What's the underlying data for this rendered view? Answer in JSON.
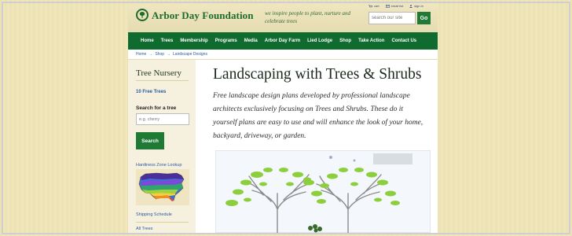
{
  "header": {
    "logo_text": "Arbor Day Foundation",
    "tagline": "we inspire people to plant, nurture and celebrate trees",
    "util_links": [
      "cart",
      "email list",
      "sign in"
    ],
    "search_placeholder": "search our site",
    "go_label": "Go"
  },
  "nav": {
    "items": [
      "Home",
      "Trees",
      "Membership",
      "Programs",
      "Media",
      "Arbor Day Farm",
      "Lied Lodge",
      "Shop",
      "Take Action",
      "Contact Us"
    ]
  },
  "breadcrumb": {
    "items": [
      "Home",
      "Shop",
      "Landscape Designs"
    ],
    "separator": "→"
  },
  "sidebar": {
    "title": "Tree Nursery",
    "free_trees_link": "10 Free Trees",
    "search_label": "Search for a tree",
    "search_placeholder": "e.g. cherry",
    "search_button": "Search",
    "hardiness_link": "Hardiness Zone Lookup",
    "shipping_link": "Shipping Schedule",
    "all_trees_link": "All Trees"
  },
  "main": {
    "title": "Landscaping with Trees & Shrubs",
    "intro": "Free landscape design plans developed by professional landscape architects exclusively focusing on Trees and Shrubs. These do it yourself plans are easy to use and will enhance the look of your home, backyard, driveway, or garden."
  },
  "colors": {
    "brand_green": "#0f6b2e",
    "button_green": "#1f7a36",
    "link_blue": "#2a5aa0",
    "background_paper": "#efe5b8"
  },
  "icons": {
    "logo": "tree-logo-icon",
    "cart": "cart-icon",
    "email": "email-icon",
    "sign_in": "user-icon"
  }
}
